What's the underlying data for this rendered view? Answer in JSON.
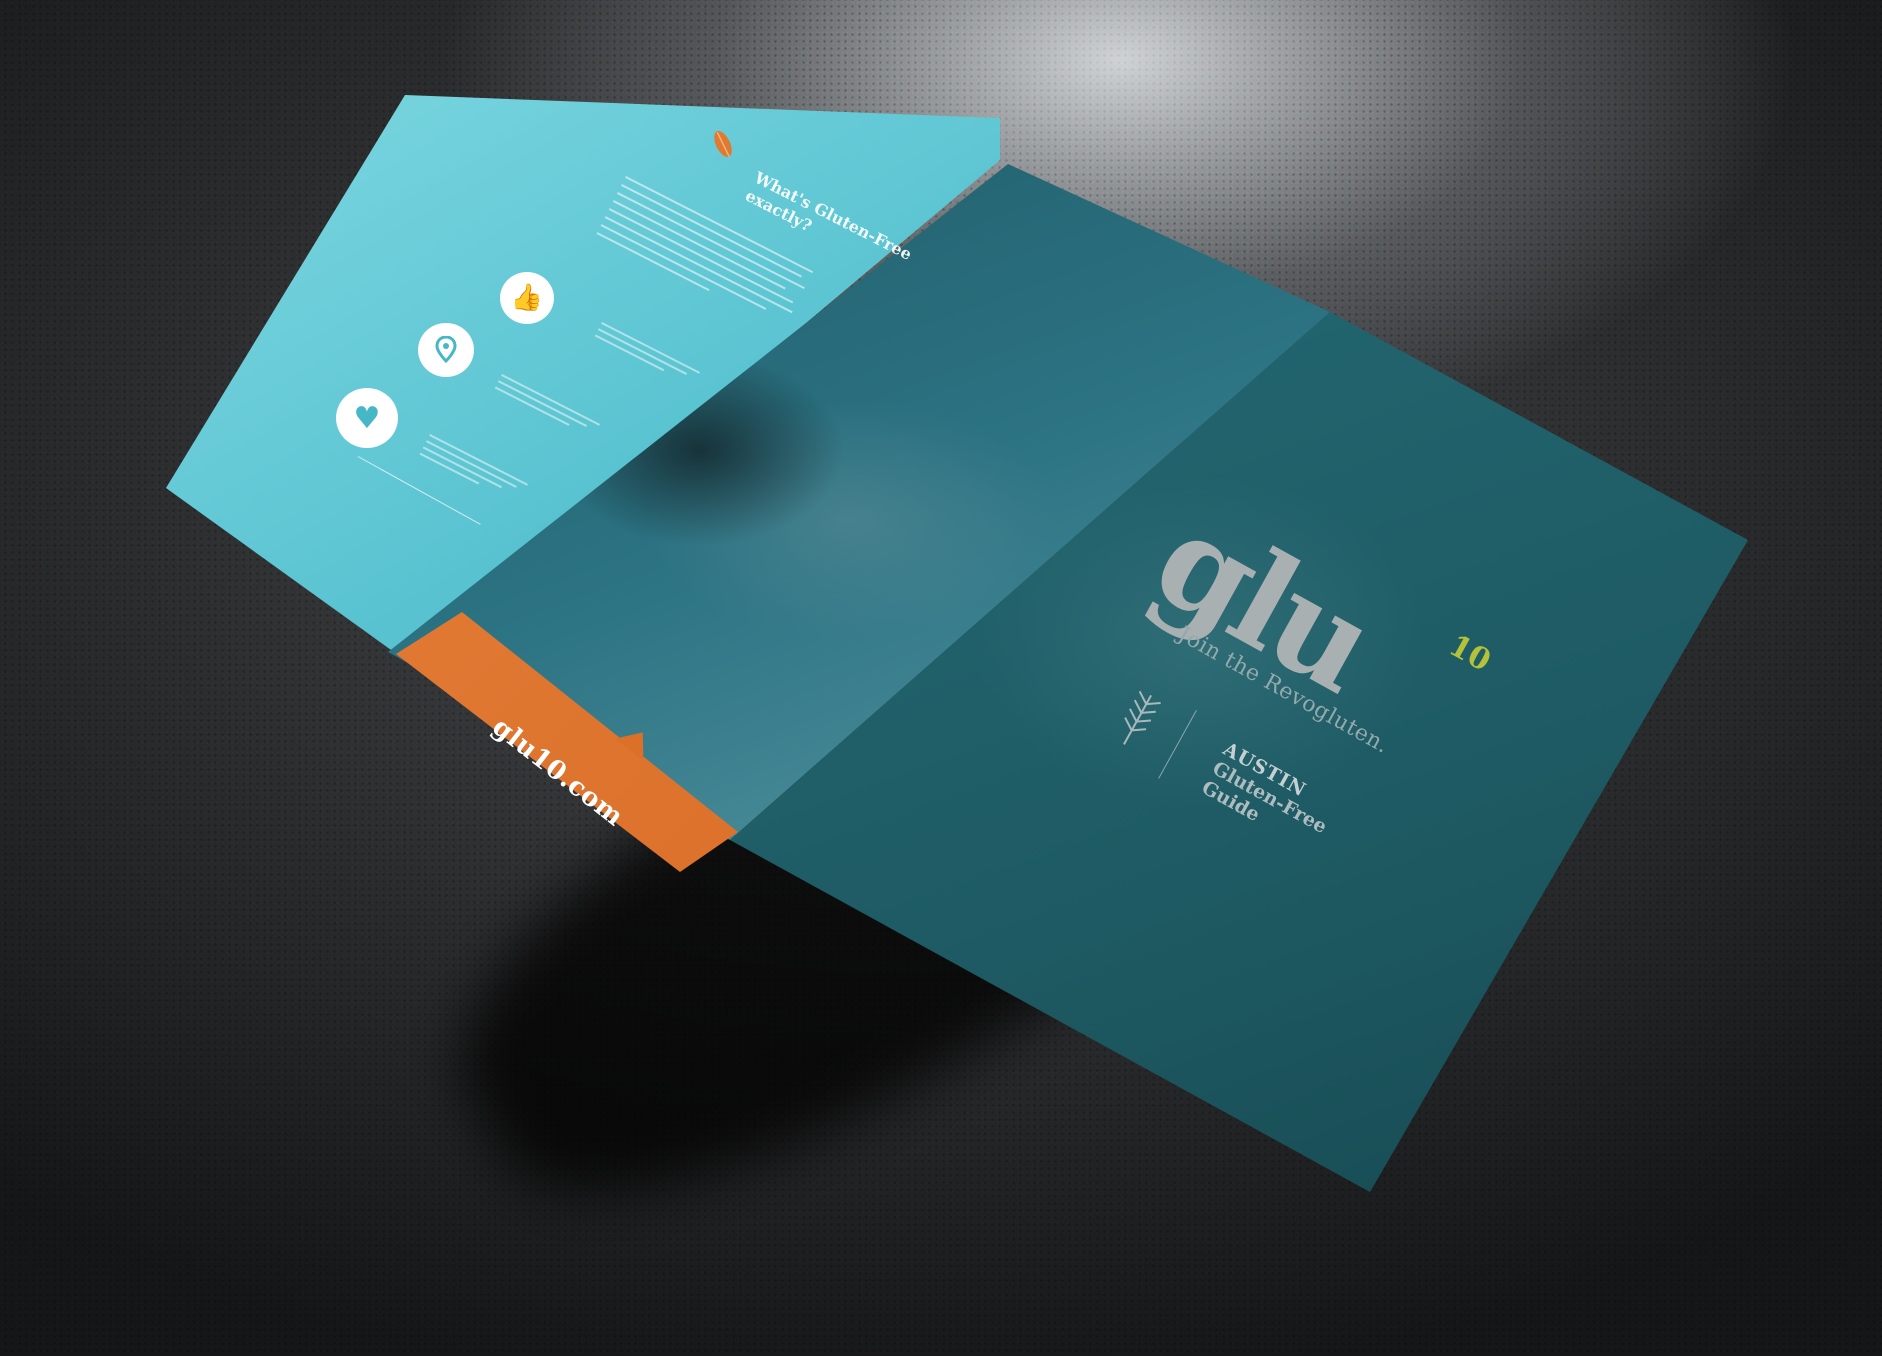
{
  "scene": {
    "description_type": "trifold brochure mockup on dark textured surface"
  },
  "left_panel": {
    "heading": "What's Gluten-Free exactly?",
    "icons": [
      "thumbs-up-icon",
      "map-pin-icon",
      "heart-icon"
    ]
  },
  "band": {
    "website": "glu10.com"
  },
  "cover": {
    "logo": "glu",
    "logo_superscript": "10",
    "tagline": "Join the Revogluten.",
    "city": "AUSTIN",
    "guide_line1": "Gluten-Free",
    "guide_line2": "Guide"
  },
  "colors": {
    "teal_light": "#58c2d0",
    "teal_dark": "#1d5963",
    "orange": "#d96d26",
    "logo_accent": "#b3c23a"
  }
}
